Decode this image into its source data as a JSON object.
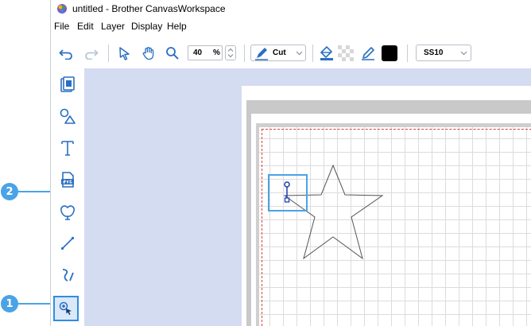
{
  "window": {
    "title": "untitled - Brother CanvasWorkspace"
  },
  "menu": [
    "File",
    "Edit",
    "Layer",
    "Display",
    "Help"
  ],
  "toolbar": {
    "zoom_value": "40",
    "zoom_unit": "%",
    "mode_label": "Cut",
    "fill_color": "#000000",
    "mat_size": "SS10"
  },
  "sidebar": {
    "tools": [
      {
        "icon": "pattern-icon"
      },
      {
        "icon": "shapes-icon"
      },
      {
        "icon": "text-icon"
      },
      {
        "icon": "svg-icon"
      },
      {
        "icon": "apple-shape-icon"
      },
      {
        "icon": "line-icon"
      },
      {
        "icon": "freehand-icon"
      },
      {
        "icon": "node-edit-icon"
      }
    ]
  },
  "callouts": {
    "one": "1",
    "two": "2"
  },
  "colors": {
    "accent": "#4aa3e6",
    "canvas": "#d3dcf0",
    "cut_line": "#e04040"
  }
}
